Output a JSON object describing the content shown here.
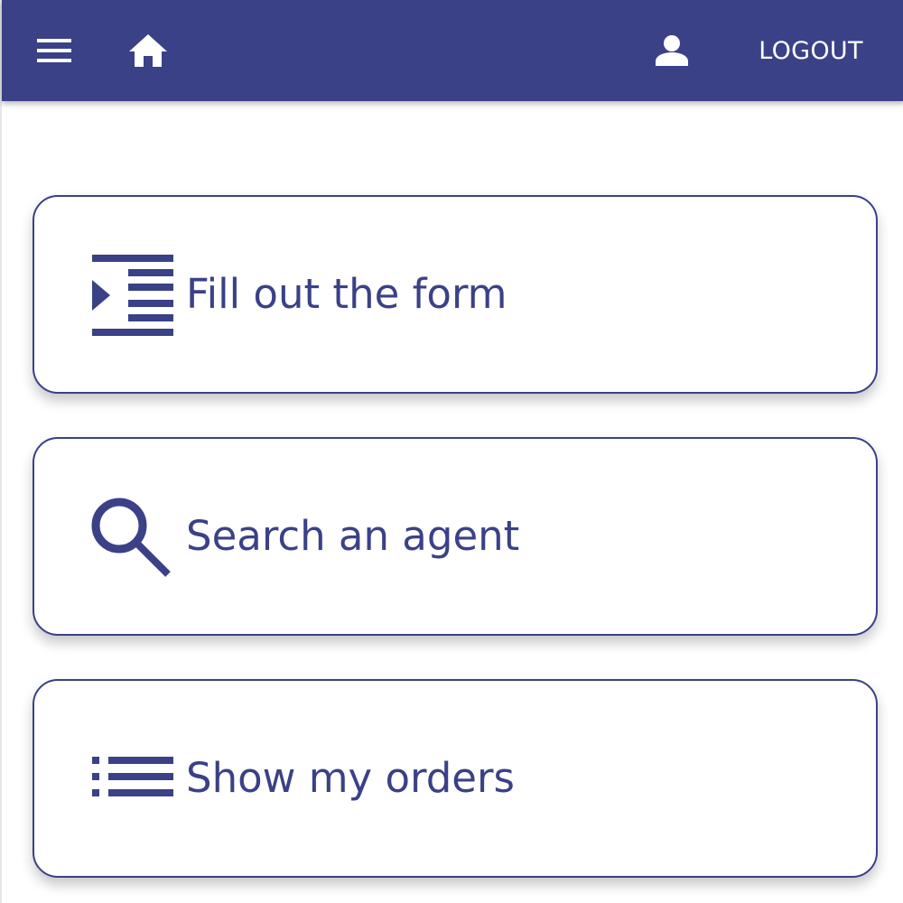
{
  "theme": {
    "primary": "#3a4187",
    "on_primary": "#ffffff",
    "background": "#ffffff"
  },
  "toolbar": {
    "menu_icon": "hamburger-menu-icon",
    "home_icon": "home-icon",
    "user_icon": "person-icon",
    "logout_label": "LOGOUT"
  },
  "actions": [
    {
      "icon": "form-indent-icon",
      "label": "Fill out the form"
    },
    {
      "icon": "search-icon",
      "label": "Search an agent"
    },
    {
      "icon": "list-icon",
      "label": "Show my orders"
    }
  ]
}
